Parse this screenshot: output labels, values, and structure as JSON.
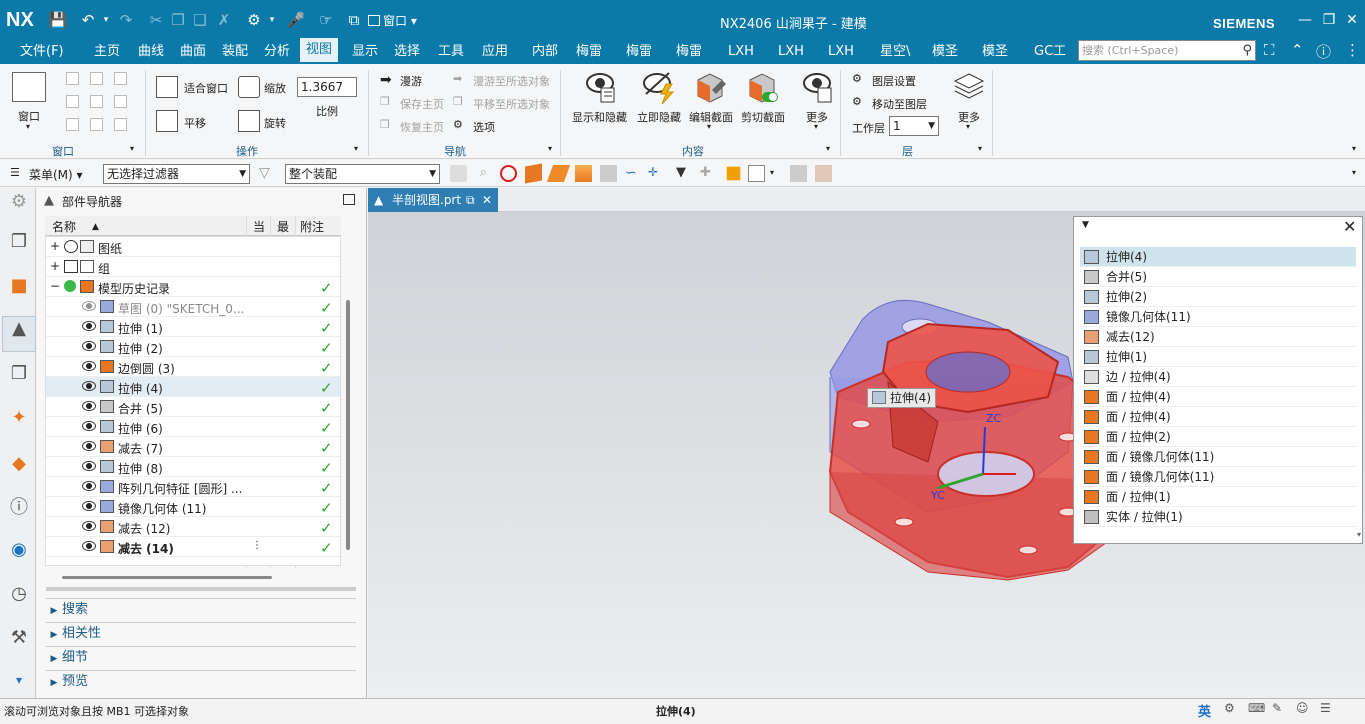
{
  "app": {
    "logo": "NX",
    "window_title": "NX2406 山涧果子 - 建模",
    "brand": "SIEMENS",
    "window_menu": "窗口"
  },
  "menu": {
    "file": "文件(F)",
    "tabs": [
      "主页",
      "曲线",
      "曲面",
      "装配",
      "分析",
      "视图",
      "显示",
      "选择",
      "工具",
      "应用",
      "内部",
      "梅雷",
      "梅雷",
      "梅雷",
      "LXH",
      "LXH",
      "LXH",
      "星空\\",
      "模圣",
      "模圣",
      "GC工"
    ],
    "active_tab": "视图",
    "search_placeholder": "搜索 (Ctrl+Space)"
  },
  "ribbon": {
    "window_group": {
      "label": "窗口",
      "window_btn": "窗口"
    },
    "operation_group": {
      "label": "操作",
      "fit": "适合窗口",
      "zoom": "缩放",
      "scale_value": "1.3667",
      "scale_label": "比例",
      "pan": "平移",
      "rotate": "旋转"
    },
    "navigation_group": {
      "label": "导航",
      "walk": "漫游",
      "save_main": "保存主页",
      "restore_main": "恢复主页",
      "walk_to_selected": "漫游至所选对象",
      "pan_to_selected": "平移至所选对象",
      "options": "选项"
    },
    "content_group": {
      "label": "内容",
      "show_hide": "显示和隐藏",
      "immediate_hide": "立即隐藏",
      "edit_section": "编辑截面",
      "clip_section": "剪切截面",
      "more": "更多"
    },
    "layer_group": {
      "label": "层",
      "layer_settings": "图层设置",
      "move_to_layer": "移动至图层",
      "work_layer_label": "工作层",
      "work_layer_value": "1",
      "more": "更多"
    }
  },
  "selection_bar": {
    "menu": "菜单(M)",
    "filter": "无选择过滤器",
    "scope": "整个装配"
  },
  "navigator": {
    "title": "部件导航器",
    "columns": {
      "name": "名称",
      "current": "当",
      "latest": "最",
      "comment": "附注"
    },
    "rows": [
      {
        "label": "图纸",
        "indent": 0,
        "check": false
      },
      {
        "label": "组",
        "indent": 0,
        "check": false
      },
      {
        "label": "模型历史记录",
        "indent": 0,
        "check": true
      },
      {
        "label": "草图 (0) \"SKETCH_0...",
        "indent": 1,
        "check": true,
        "disabled": true
      },
      {
        "label": "拉伸 (1)",
        "indent": 1,
        "check": true
      },
      {
        "label": "拉伸 (2)",
        "indent": 1,
        "check": true
      },
      {
        "label": "边倒圆 (3)",
        "indent": 1,
        "check": true
      },
      {
        "label": "拉伸 (4)",
        "indent": 1,
        "check": true,
        "selected": true
      },
      {
        "label": "合并 (5)",
        "indent": 1,
        "check": true
      },
      {
        "label": "拉伸 (6)",
        "indent": 1,
        "check": true
      },
      {
        "label": "减去 (7)",
        "indent": 1,
        "check": true
      },
      {
        "label": "拉伸 (8)",
        "indent": 1,
        "check": true
      },
      {
        "label": "阵列几何特征 [圆形] ...",
        "indent": 1,
        "check": true
      },
      {
        "label": "镜像几何体 (11)",
        "indent": 1,
        "check": true
      },
      {
        "label": "减去 (12)",
        "indent": 1,
        "check": true
      },
      {
        "label": "减去 (14)",
        "indent": 1,
        "check": true,
        "bold": true
      }
    ],
    "sections": [
      "搜索",
      "相关性",
      "细节",
      "预览"
    ]
  },
  "graphics": {
    "tab_label": "半剖视图.prt",
    "tooltip": "拉伸(4)",
    "axis_labels": {
      "zc": "ZC",
      "yc": "YC"
    }
  },
  "popup_list": [
    {
      "label": "拉伸(4)",
      "selected": true,
      "icon": "extrude-icon"
    },
    {
      "label": "合并(5)",
      "icon": "unite-icon"
    },
    {
      "label": "拉伸(2)",
      "icon": "extrude-icon"
    },
    {
      "label": "镜像几何体(11)",
      "icon": "mirror-icon"
    },
    {
      "label": "减去(12)",
      "icon": "subtract-icon"
    },
    {
      "label": "拉伸(1)",
      "icon": "extrude-icon"
    },
    {
      "label": "边 / 拉伸(4)",
      "icon": "edge-icon"
    },
    {
      "label": "面 / 拉伸(4)",
      "icon": "face-icon"
    },
    {
      "label": "面 / 拉伸(4)",
      "icon": "face-icon"
    },
    {
      "label": "面 / 拉伸(2)",
      "icon": "face-icon"
    },
    {
      "label": "面 / 镜像几何体(11)",
      "icon": "face-icon"
    },
    {
      "label": "面 / 镜像几何体(11)",
      "icon": "face-icon"
    },
    {
      "label": "面 / 拉伸(1)",
      "icon": "face-icon"
    },
    {
      "label": "实体 / 拉伸(1)",
      "icon": "body-icon"
    }
  ],
  "status": {
    "left": "滚动可浏览对象且按 MB1 可选择对象",
    "center": "拉伸(4)",
    "ime": "英"
  },
  "colors": {
    "titlebar": "#0b7aa8",
    "selected_body": "#e8453c",
    "ghost_body": "#8f8fe0"
  }
}
